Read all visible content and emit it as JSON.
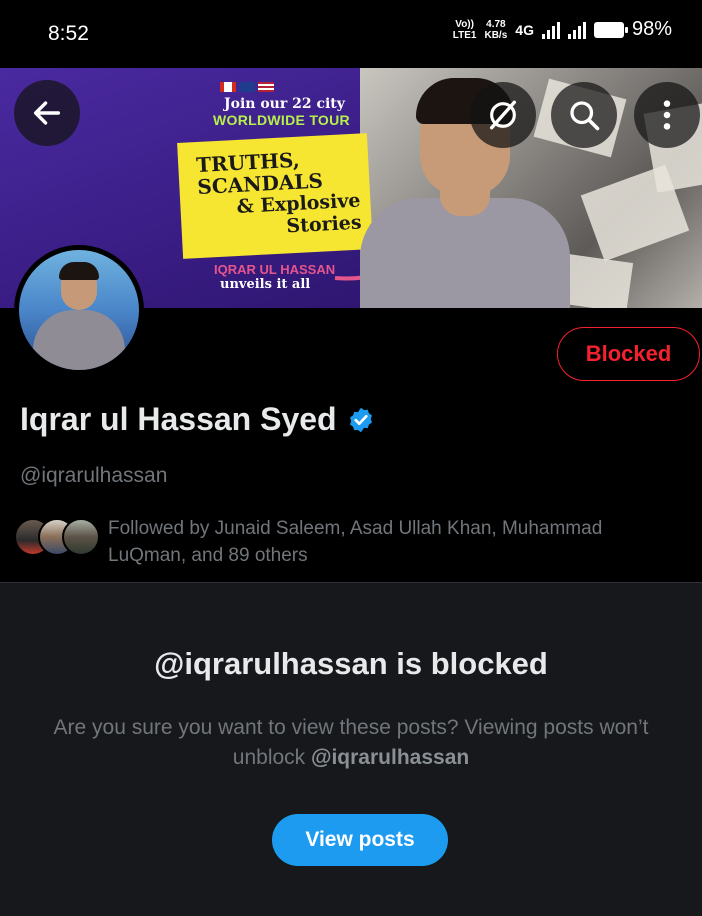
{
  "status_bar": {
    "time": "8:52",
    "volte": "Vo))",
    "lte": "LTE1",
    "speed": "4.78",
    "speed_unit": "KB/s",
    "network": "4G",
    "battery": "98%"
  },
  "banner": {
    "tour_line1": "Join our 22 city",
    "tour_line2": "WORLDWIDE TOUR",
    "headline_1": "TRUTHS,",
    "headline_2": "SCANDALS",
    "headline_3": "& Explosive",
    "headline_4": "Stories",
    "host": "IQRAR UL HASSAN",
    "tagline": "unveils it all"
  },
  "toolbar": {
    "back_icon": "arrow-left-icon",
    "grok_icon": "grok-icon",
    "search_icon": "search-icon",
    "more_icon": "more-vertical-icon"
  },
  "profile": {
    "display_name": "Iqrar ul Hassan Syed",
    "handle": "@iqrarulhassan",
    "verified": true,
    "blocked_label": "Blocked",
    "followed_by": "Followed by Junaid Saleem, Asad Ullah Khan, Muhammad LuQman, and 89 others"
  },
  "blocked_notice": {
    "title": "@iqrarulhassan is blocked",
    "desc_prefix": "Are you sure you want to view these posts? Viewing posts won’t unblock ",
    "desc_handle": "@iqrarulhassan",
    "button_label": "View posts"
  },
  "colors": {
    "accent": "#1d9bf0",
    "blocked_red": "#f4212e",
    "muted_text": "#71767b",
    "panel_bg": "#16181c"
  }
}
